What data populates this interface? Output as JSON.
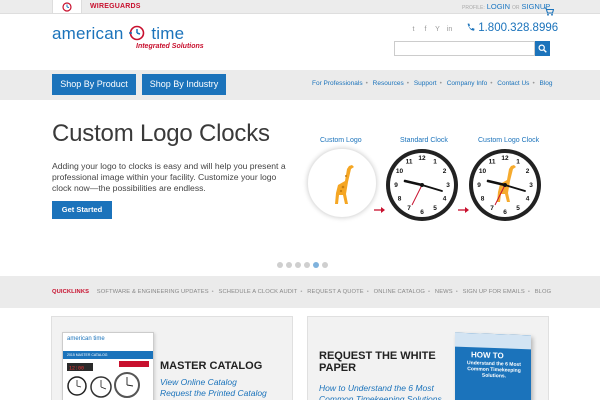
{
  "topbar": {
    "tab_label": "WIREGUARDS",
    "profile_label": "PROFILE:",
    "login_label": "LOGIN",
    "or_label": "OR",
    "signup_label": "SIGNUP"
  },
  "header": {
    "logo_text": "american time",
    "logo_sub": "Integrated Solutions",
    "phone": "1.800.328.8996",
    "search_placeholder": "",
    "social_icons": [
      "twitter-icon",
      "facebook-icon",
      "youtube-icon",
      "linkedin-icon"
    ],
    "social_glyphs": [
      "t",
      "f",
      "Y",
      "in"
    ]
  },
  "nav": {
    "shop_by_product": "Shop By Product",
    "shop_by_industry": "Shop By Industry",
    "links": [
      "For Professionals",
      "Resources",
      "Support",
      "Company Info",
      "Contact Us",
      "Blog"
    ]
  },
  "hero": {
    "title": "Custom Logo Clocks",
    "text": "Adding your logo to clocks is easy and will help you present a professional image within your facility. Customize your logo clock now—the possibilities are endless.",
    "cta": "Get Started",
    "label_custom_logo": "Custom Logo",
    "label_standard_clock": "Standard Clock",
    "label_custom_logo_clock": "Custom Logo Clock",
    "slides_count": 6,
    "active_slide": 5
  },
  "quicklinks": {
    "lead": "QUICKLINKS",
    "items": [
      "SOFTWARE & ENGINEERING UPDATES",
      "SCHEDULE A CLOCK AUDIT",
      "REQUEST A QUOTE",
      "ONLINE CATALOG",
      "NEWS",
      "SIGN UP FOR EMAILS",
      "BLOG"
    ]
  },
  "catalog": {
    "image_head": "american time",
    "image_band": "2015 MASTER CATALOG",
    "title": "MASTER CATALOG",
    "link_view": "View Online Catalog",
    "link_request": "Request the Printed Catalog"
  },
  "whitepaper": {
    "title": "REQUEST THE WHITE PAPER",
    "link": "How to Understand the 6 Most Common Timekeeping Solutions",
    "book_heading": "HOW TO",
    "book_sub": "Understand the 6 Most Common Timekeeping Solutions."
  },
  "colors": {
    "brand_blue": "#1b73bb",
    "brand_red": "#c8102e"
  }
}
